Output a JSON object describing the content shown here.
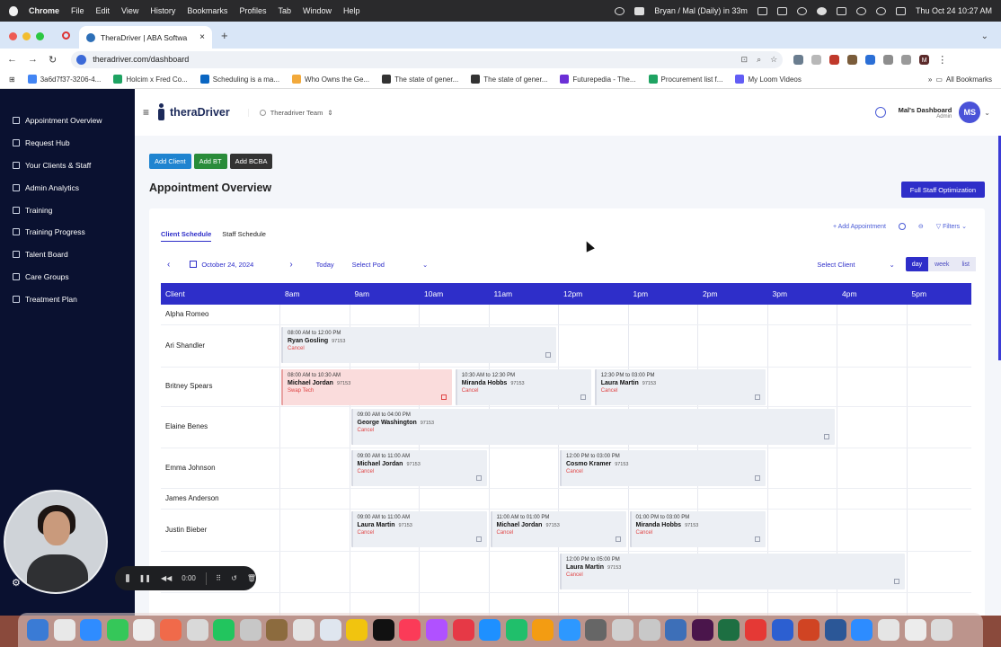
{
  "menubar": {
    "app": "Chrome",
    "items": [
      "File",
      "Edit",
      "View",
      "History",
      "Bookmarks",
      "Profiles",
      "Tab",
      "Window",
      "Help"
    ],
    "meeting": "Bryan / Mal (Daily) in 33m",
    "datetime": "Thu Oct 24  10:27 AM"
  },
  "browser": {
    "tab_title": "TheraDriver | ABA Softwa",
    "url": "theradriver.com/dashboard",
    "profile_initial": "M",
    "bookmarks": [
      {
        "label": "3a6d7f37-3206-4...",
        "color": "#4285f4"
      },
      {
        "label": "Holcim x Fred Co...",
        "color": "#1ea362"
      },
      {
        "label": "Scheduling is a ma...",
        "color": "#0a66c2"
      },
      {
        "label": "Who Owns the Ge...",
        "color": "#f2a93b"
      },
      {
        "label": "The state of gener...",
        "color": "#333333"
      },
      {
        "label": "The state of gener...",
        "color": "#333333"
      },
      {
        "label": "Futurepedia - The...",
        "color": "#6b2fd6"
      },
      {
        "label": "Procurement list f...",
        "color": "#1ea362"
      },
      {
        "label": "My Loom Videos",
        "color": "#625df5"
      }
    ],
    "all_bookmarks": "All Bookmarks"
  },
  "sidebar": {
    "items": [
      "Appointment Overview",
      "Request Hub",
      "Your Clients & Staff",
      "Admin Analytics",
      "Training",
      "Training Progress",
      "Talent Board",
      "Care Groups",
      "Treatment Plan"
    ]
  },
  "header": {
    "brand": "theraDriver",
    "team": "Theradriver Team",
    "dashboard_title": "Mal's Dashboard",
    "role": "Admin",
    "avatar_initials": "MS"
  },
  "actions": {
    "add_client": "Add Client",
    "add_bt": "Add BT",
    "add_bcba": "Add BCBA",
    "page_title": "Appointment Overview",
    "optimize": "Full Staff Optimization"
  },
  "schedule": {
    "tabs": [
      "Client Schedule",
      "Staff Schedule"
    ],
    "add_appointment": "Add Appointment",
    "filters": "Filters",
    "date": "October 24, 2024",
    "today": "Today",
    "select_pod": "Select Pod",
    "select_client": "Select Client",
    "views": [
      "day",
      "week",
      "list"
    ],
    "column_client": "Client",
    "hours": [
      "8am",
      "9am",
      "10am",
      "11am",
      "12pm",
      "1pm",
      "2pm",
      "3pm",
      "4pm",
      "5pm"
    ],
    "clients": [
      "Alpha Romeo",
      "Ari Shandler",
      "Britney Spears",
      "Elaine Benes",
      "Emma Johnson",
      "James Anderson",
      "Justin Bieber",
      ""
    ],
    "appointments": [
      {
        "row": 1,
        "start": 8,
        "end": 12,
        "time": "08:00 AM to 12:00 PM",
        "staff": "Ryan Gosling",
        "code": "97153",
        "action": "Cancel",
        "style": "normal"
      },
      {
        "row": 2,
        "start": 8,
        "end": 10.5,
        "time": "08:00 AM to 10:30 AM",
        "staff": "Michael Jordan",
        "code": "97153",
        "action": "Swap Tech",
        "style": "pink"
      },
      {
        "row": 2,
        "start": 10.5,
        "end": 12.5,
        "time": "10:30 AM to 12:30 PM",
        "staff": "Miranda Hobbs",
        "code": "97153",
        "action": "Cancel",
        "style": "normal"
      },
      {
        "row": 2,
        "start": 12.5,
        "end": 15,
        "time": "12:30 PM to 03:00 PM",
        "staff": "Laura Martin",
        "code": "97153",
        "action": "Cancel",
        "style": "normal"
      },
      {
        "row": 3,
        "start": 9,
        "end": 16,
        "time": "09:00 AM to 04:00 PM",
        "staff": "George Washington",
        "code": "97153",
        "action": "Cancel",
        "style": "normal"
      },
      {
        "row": 4,
        "start": 9,
        "end": 11,
        "time": "09:00 AM to 11:00 AM",
        "staff": "Michael Jordan",
        "code": "97153",
        "action": "Cancel",
        "style": "normal"
      },
      {
        "row": 4,
        "start": 12,
        "end": 15,
        "time": "12:00 PM to 03:00 PM",
        "staff": "Cosmo Kramer",
        "code": "97153",
        "action": "Cancel",
        "style": "normal"
      },
      {
        "row": 6,
        "start": 9,
        "end": 11,
        "time": "09:00 AM to 11:00 AM",
        "staff": "Laura Martin",
        "code": "97153",
        "action": "Cancel",
        "style": "normal"
      },
      {
        "row": 6,
        "start": 11,
        "end": 13,
        "time": "11:00 AM to 01:00 PM",
        "staff": "Michael Jordan",
        "code": "97153",
        "action": "Cancel",
        "style": "normal"
      },
      {
        "row": 6,
        "start": 13,
        "end": 15,
        "time": "01:00 PM to 03:00 PM",
        "staff": "Miranda Hobbs",
        "code": "97153",
        "action": "Cancel",
        "style": "normal"
      },
      {
        "row": 7,
        "start": 12,
        "end": 17,
        "time": "12:00 PM to 05:00 PM",
        "staff": "Laura Martin",
        "code": "97153",
        "action": "Cancel",
        "style": "normal"
      }
    ]
  },
  "recorder": {
    "time": "0:00"
  }
}
